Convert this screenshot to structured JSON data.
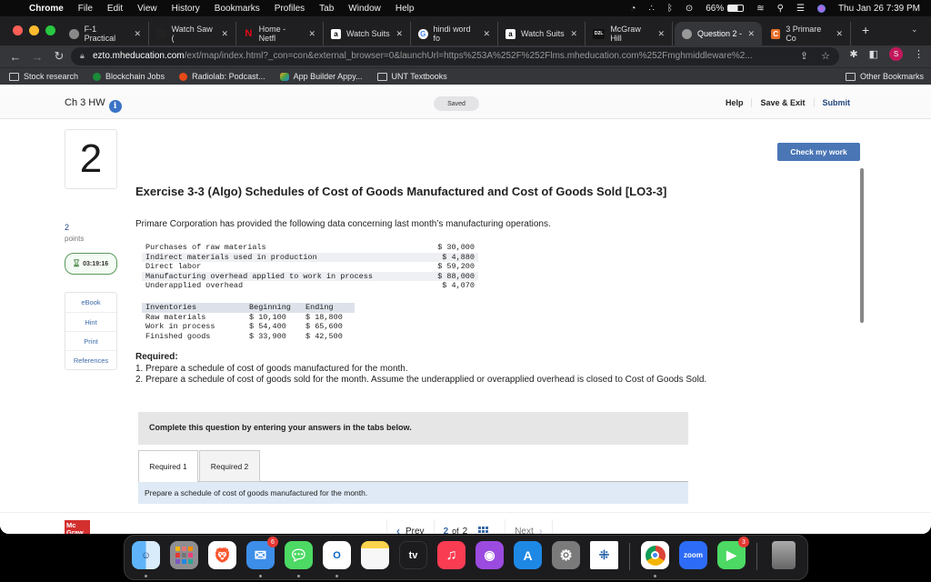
{
  "menubar": {
    "app": "Chrome",
    "items": [
      "File",
      "Edit",
      "View",
      "History",
      "Bookmarks",
      "Profiles",
      "Tab",
      "Window",
      "Help"
    ],
    "battery": "66%",
    "datetime": "Thu Jan 26  7:39 PM"
  },
  "browser": {
    "tabs": [
      {
        "label": "F-1 Practical",
        "icon": "globe-icon"
      },
      {
        "label": "Watch Saw (",
        "icon": "site-icon"
      },
      {
        "label": "Home - Netfl",
        "icon": "netflix-icon"
      },
      {
        "label": "Watch Suits",
        "icon": "amazon-icon"
      },
      {
        "label": "hindi word fo",
        "icon": "google-icon"
      },
      {
        "label": "Watch Suits",
        "icon": "amazon-icon"
      },
      {
        "label": "McGraw Hill",
        "icon": "d2l-icon"
      },
      {
        "label": "Question 2 -",
        "icon": "globe-icon",
        "active": true
      },
      {
        "label": "3 Primare Co",
        "icon": "chegg-icon"
      }
    ],
    "url_domain": "ezto.mheducation.com",
    "url_rest": "/ext/map/index.html?_con=con&external_browser=0&launchUrl=https%253A%252F%252Flms.mheducation.com%252Fmghmiddleware%2...",
    "profile_initial": "S",
    "bookmarks": [
      "Stock research",
      "Blockchain Jobs",
      "Radiolab: Podcast...",
      "App Builder Appy...",
      "UNT Textbooks"
    ],
    "other_bookmarks": "Other Bookmarks"
  },
  "header": {
    "title": "Ch 3 HW",
    "saved": "Saved",
    "help": "Help",
    "save_exit": "Save & Exit",
    "submit": "Submit",
    "check_my_work": "Check my work"
  },
  "question": {
    "number": "2",
    "points": "2",
    "points_label": "points",
    "timer": "03:19:16",
    "side_links": [
      "eBook",
      "Hint",
      "Print",
      "References"
    ],
    "title": "Exercise 3-3 (Algo) Schedules of Cost of Goods Manufactured and Cost of Goods Sold [LO3-3]",
    "intro": "Primare Corporation has provided the following data concerning last month’s manufacturing operations.",
    "costs": [
      {
        "label": "Purchases of raw materials",
        "value": "$ 30,000"
      },
      {
        "label": "Indirect materials used in production",
        "value": "$ 4,880"
      },
      {
        "label": "Direct labor",
        "value": "$ 59,200"
      },
      {
        "label": "Manufacturing overhead applied to work in process",
        "value": "$ 88,000"
      },
      {
        "label": "Underapplied overhead",
        "value": "$ 4,070"
      }
    ],
    "inventory_headers": [
      "Inventories",
      "Beginning",
      "Ending"
    ],
    "inventories": [
      {
        "label": "Raw materials",
        "beginning": "$ 10,100",
        "ending": "$ 18,800"
      },
      {
        "label": "Work in process",
        "beginning": "$ 54,400",
        "ending": "$ 65,600"
      },
      {
        "label": "Finished goods",
        "beginning": "$ 33,900",
        "ending": "$ 42,500"
      }
    ],
    "required_heading": "Required:",
    "required_items": [
      "1. Prepare a schedule of cost of goods manufactured for the month.",
      "2. Prepare a schedule of cost of goods sold for the month. Assume the underapplied or overapplied overhead is closed to Cost of Goods Sold."
    ],
    "complete_note": "Complete this question by entering your answers in the tabs below.",
    "answer_tabs": [
      "Required 1",
      "Required 2"
    ],
    "tab_description": "Prepare a schedule of cost of goods manufactured for the month."
  },
  "footer": {
    "logo": "Mc Graw Hill",
    "prev": "Prev",
    "current_page": "2",
    "of_label": "of",
    "total_pages": "2",
    "next": "Next"
  },
  "dock": {
    "apps": [
      "Finder",
      "Launchpad",
      "Brave",
      "Mail",
      "Messages",
      "Outlook",
      "Notes",
      "Apple TV",
      "Music",
      "Podcasts",
      "App Store",
      "System Preferences",
      "Tableau",
      "Chrome",
      "Zoom",
      "FaceTime",
      "Trash"
    ],
    "mail_badge": "6",
    "facetime_badge": "3",
    "tv_label": "tv",
    "zoom_label": "zoom"
  }
}
